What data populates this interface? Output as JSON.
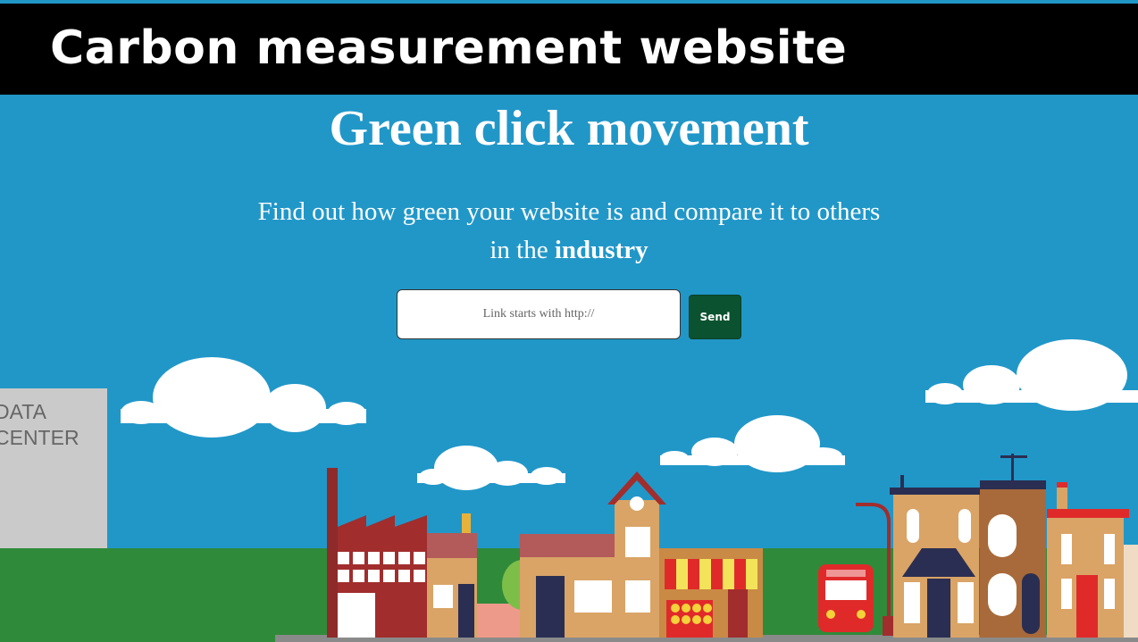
{
  "header": {
    "title": "Carbon measurement website"
  },
  "hero": {
    "title": "Green click movement",
    "subtitle_line1": "Find out how green your website is and compare it to others",
    "subtitle_line2_prefix": "in the ",
    "subtitle_line2_bold": "industry"
  },
  "form": {
    "input_placeholder": "Link starts with http://",
    "send_label": "Send"
  },
  "illustration": {
    "datacenter_line1": "DATA",
    "datacenter_line2": "CENTER"
  },
  "colors": {
    "sky": "#2197c8",
    "header_bg": "#000000",
    "send_button": "#0b5230",
    "grass": "#2f8a3a"
  }
}
